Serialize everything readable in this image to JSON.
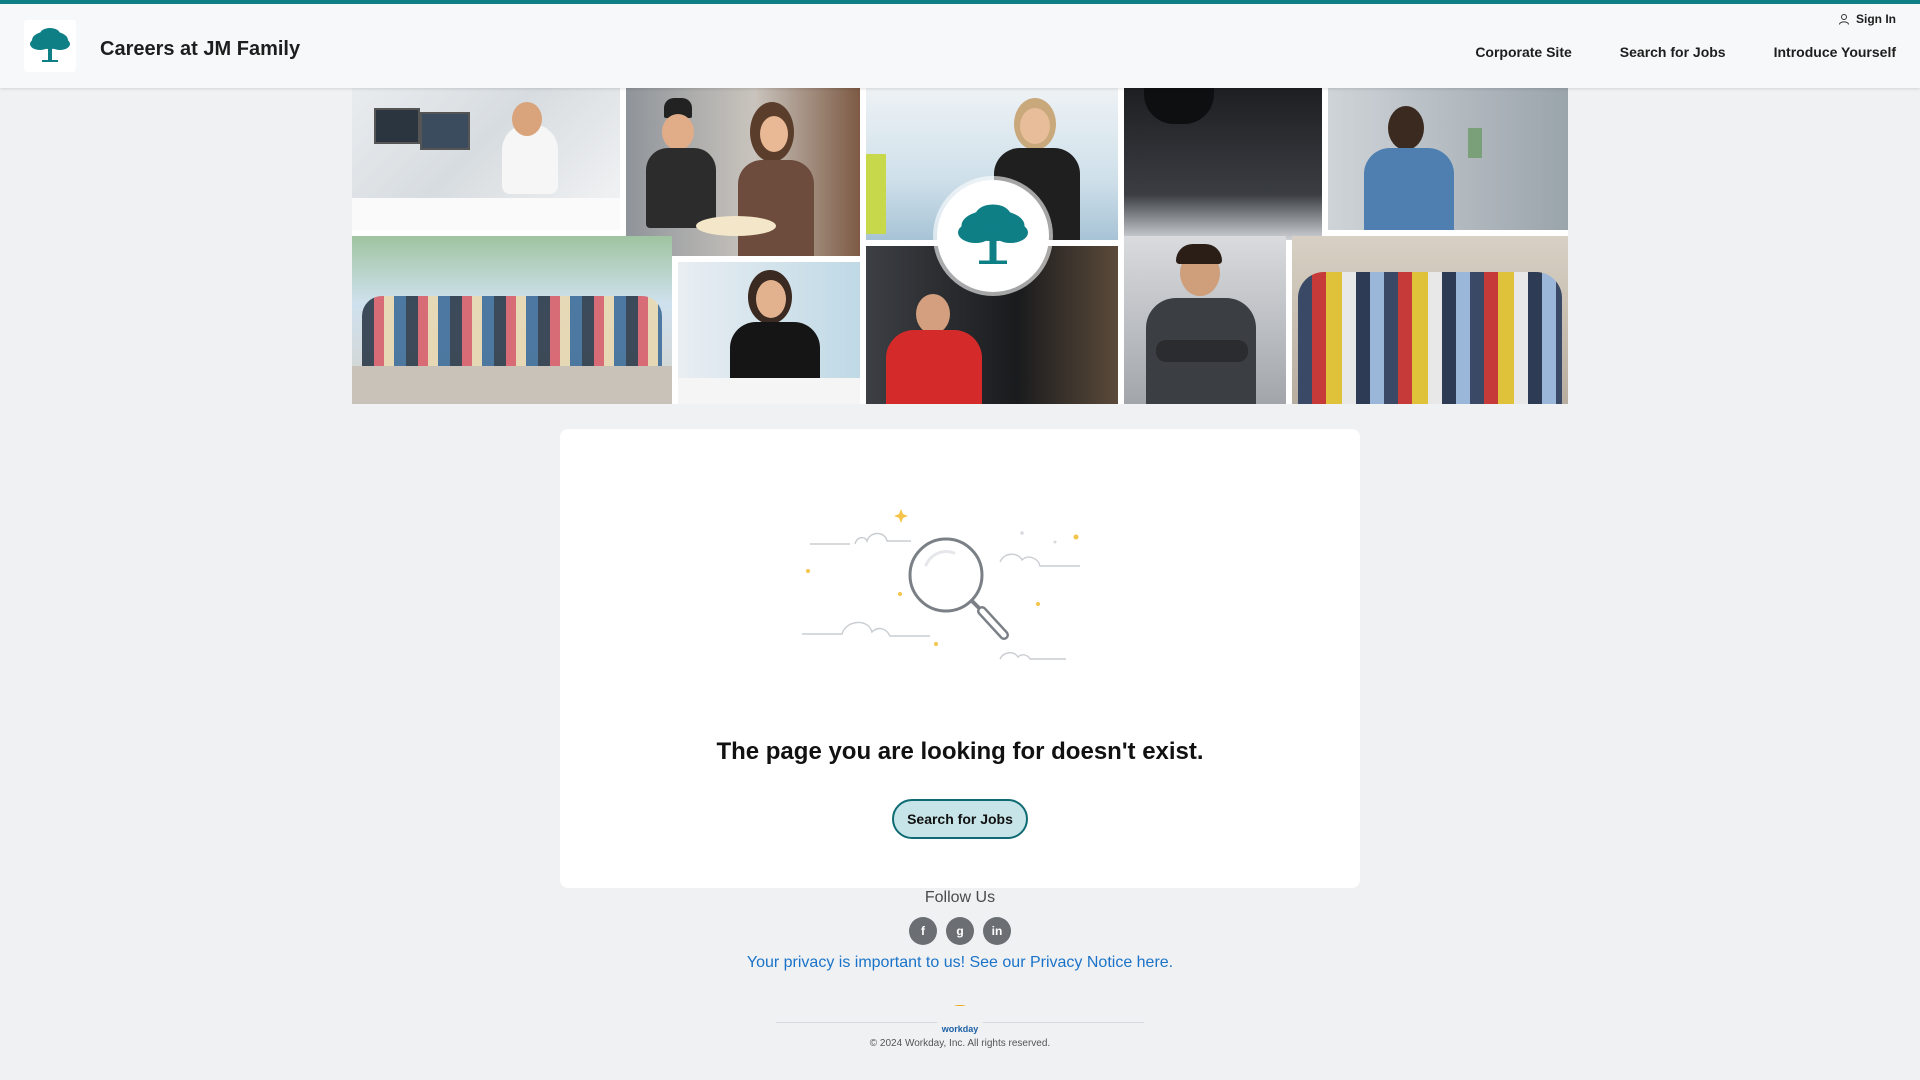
{
  "header": {
    "site_title": "Careers at JM Family",
    "sign_in": "Sign In",
    "nav": [
      "Corporate Site",
      "Search for Jobs",
      "Introduce Yourself"
    ]
  },
  "banner": {
    "tiles": [
      {
        "name": "photo-office-desk",
        "desc": "man at computer"
      },
      {
        "name": "photo-chef-and-server",
        "desc": "chef and woman with food"
      },
      {
        "name": "photo-woman-in-store",
        "desc": "woman in showroom"
      },
      {
        "name": "photo-car-underside",
        "desc": "vehicle lift"
      },
      {
        "name": "photo-man-smiling",
        "desc": "man in blue shirt"
      },
      {
        "name": "photo-group-dock",
        "desc": "group waving at dock"
      },
      {
        "name": "photo-woman-laptop",
        "desc": "woman with laptop"
      },
      {
        "name": "photo-man-coffee",
        "desc": "man in red shirt"
      },
      {
        "name": "photo-technician",
        "desc": "technician arms crossed"
      },
      {
        "name": "photo-team-group",
        "desc": "team group photo"
      }
    ]
  },
  "card": {
    "title": "The page you are looking for doesn't exist.",
    "button": "Search for Jobs"
  },
  "footer": {
    "follow": "Follow Us",
    "socials": [
      "f",
      "g",
      "in"
    ],
    "privacy": "Your privacy is important to us! See our Privacy Notice here.",
    "workday": "workday",
    "copyright": "© 2024 Workday, Inc. All rights reserved."
  },
  "colors": {
    "accent": "#0f7f86",
    "button_bg": "#c7e5e8",
    "link": "#1a73c8"
  }
}
